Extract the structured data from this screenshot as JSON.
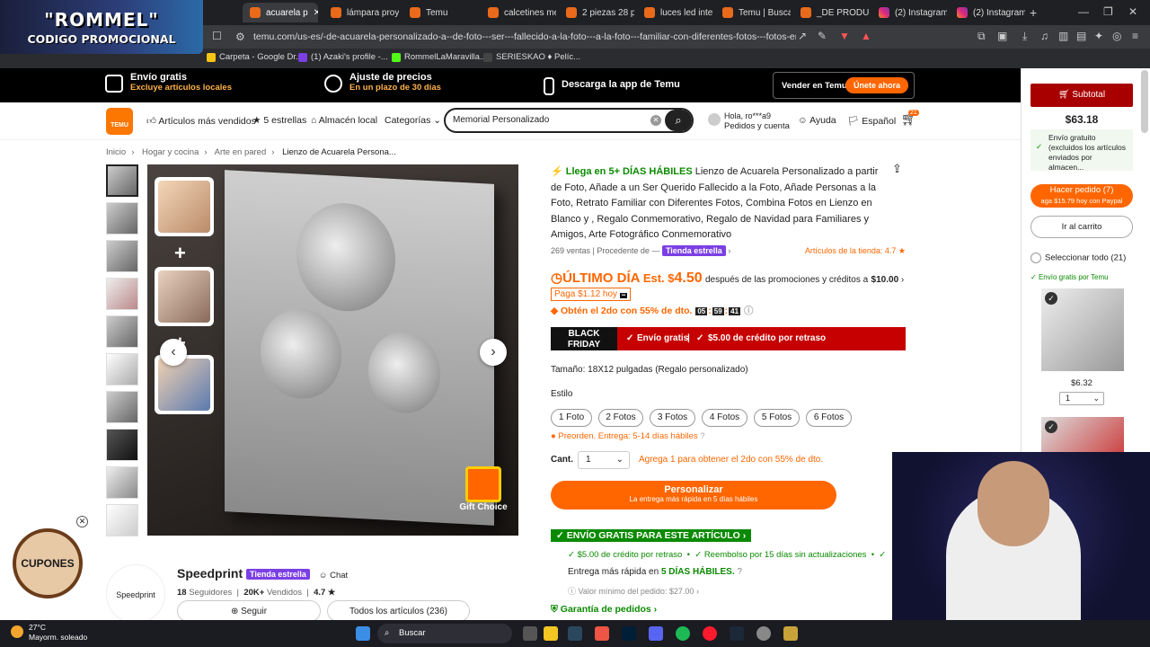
{
  "promo_overlay": {
    "line1": "\"ROMMEL\"",
    "line2": "CODIGO PROMOCIONAL"
  },
  "browser": {
    "tabs": [
      {
        "label": "acuarela p"
      },
      {
        "label": "lámpara proye"
      },
      {
        "label": "Temu"
      },
      {
        "label": "calcetines med"
      },
      {
        "label": "2 piezas 28 pie"
      },
      {
        "label": "luces led intelig"
      },
      {
        "label": "Temu | Buscar"
      },
      {
        "label": "_DE PRODUCT"
      },
      {
        "label": "(2) Instagram"
      },
      {
        "label": "(2) Instagram"
      }
    ],
    "url": "temu.com/us-es/-de-acuarela-personalizado-a--de-foto---ser---fallecido-a-la-foto---a-la-foto---familiar-con-diferentes-fotos---fotos-en---y-rega...",
    "bookmarks": [
      "Carpeta - Google Dr...",
      "(1) Azaki's profile -...",
      "RommelLaMaravilla...",
      "SERIESKAO ♦ Pelíc..."
    ]
  },
  "banner": {
    "free_ship": "Envío gratis",
    "free_ship_sub": "Excluye artículos locales",
    "price_adj": "Ajuste de precios",
    "price_adj_sub": "En un plazo de 30 días",
    "app": "Descarga la app de Temu",
    "seller": "Vender en Temu",
    "join": "Únete ahora"
  },
  "header": {
    "logo": "TEMU",
    "nav": [
      "Artículos más vendidos",
      "5 estrellas",
      "Almacén local",
      "Categorías"
    ],
    "search_value": "Memorial Personalizado",
    "account_line1": "Hola, ro***a9",
    "account_line2": "Pedidos y cuenta",
    "help": "Ayuda",
    "language": "Español",
    "cart_count": "21"
  },
  "breadcrumb": [
    "Inicio",
    "Hogar y cocina",
    "Arte en pared",
    "Lienzo de Acuarela Persona..."
  ],
  "product": {
    "delivery_lead": "Llega en 5+ DÍAS HÁBILES",
    "title": "Lienzo de Acuarela Personalizado a partir de Foto, Añade a un Ser Querido Fallecido a la Foto, Añade Personas a la Foto, Retrato Familiar con Diferentes Fotos, Combina Fotos en Lienzo en Blanco y , Regalo Conmemorativo, Regalo de Navidad para Familiares y Amigos, Arte Fotográfico Conmemorativo",
    "sales": "269 ventas",
    "origin": "Procedente de",
    "store_badge": "Tienda estrella",
    "store_rating": "Artículos de la tienda: 4.7",
    "last_day": "ÚLTIMO DÍA",
    "est": "Est. $",
    "price": "4.50",
    "after_text": "después de las promociones y créditos a",
    "after_amount": "$10.00",
    "pay_later": "Paga $1.12 hoy",
    "second_deal": "Obtén el 2do con 55% de dto.",
    "timer": [
      "05",
      "59",
      "41"
    ],
    "bf_label1": "BLACK",
    "bf_label2": "FRIDAY",
    "bf_free": "Envío gratis",
    "bf_credit": "$5.00 de crédito por retraso",
    "size": "Tamaño: 18X12 pulgadas (Regalo personalizado)",
    "style_label": "Estilo",
    "styles": [
      "1 Foto",
      "2 Fotos",
      "3 Fotos",
      "4 Fotos",
      "5 Fotos",
      "6 Fotos"
    ],
    "preorder": "Preorden. Entrega: 5-14 días hábiles",
    "qty_label": "Cant.",
    "qty_value": "1",
    "qty_hint": "Agrega 1 para obtener el 2do con 55% de dto.",
    "customize": "Personalizar",
    "customize_sub": "La entrega más rápida en 5 días hábiles",
    "ship_free": "ENVÍO GRATIS PARA ESTE ARTÍCULO",
    "ship_credit": "$5.00 de crédito por retraso",
    "ship_refund": "Reembolso por 15 días sin actualizaciones",
    "fast_delivery": "Entrega más rápida en",
    "fast_days": "5 DÍAS HÁBILES.",
    "min_order": "Valor mínimo del pedido: $27.00",
    "guarantee": "Garantía de pedidos",
    "gift": "Gift Choice"
  },
  "store": {
    "logo_text": "Speedprint",
    "name": "Speedprint",
    "badge": "Tienda estrella",
    "chat": "Chat",
    "followers": "18",
    "followers_label": "Seguidores",
    "sold": "20K+",
    "sold_label": "Vendidos",
    "rating": "4.7 ★",
    "follow": "Seguir",
    "all_items": "Todos los artículos (236)"
  },
  "coupon": {
    "label": "CUPONES"
  },
  "sidebar": {
    "subtotal": "Subtotal",
    "total": "$63.18",
    "free_text": "Envío gratuito (excluidos los artículos enviados por almacen...",
    "order_btn": "Hacer pedido (7)",
    "order_sub": "aga $15.79 hoy con Paypal",
    "to_cart": "Ir al carrito",
    "select_all": "Seleccionar todo (21)",
    "free_by_temu": "Envío gratis por Temu",
    "item_price": "$6.32",
    "item_qty": "1"
  },
  "taskbar": {
    "temp": "27°C",
    "weather": "Mayorm. soleado",
    "search": "Buscar"
  }
}
